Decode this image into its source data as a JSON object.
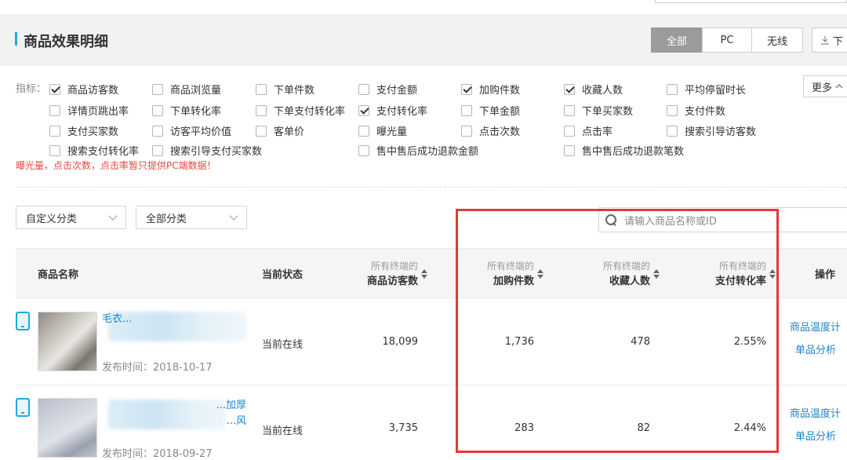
{
  "header": {
    "title": "商品效果明细",
    "tabs": [
      {
        "label": "全部",
        "active": true
      },
      {
        "label": "PC",
        "active": false
      },
      {
        "label": "无线",
        "active": false
      }
    ],
    "download_label": "下",
    "download_icon": "download-icon"
  },
  "metrics": {
    "label": "指标：",
    "items": [
      {
        "label": "商品访客数",
        "checked": true
      },
      {
        "label": "商品浏览量",
        "checked": false
      },
      {
        "label": "下单件数",
        "checked": false
      },
      {
        "label": "支付金额",
        "checked": false
      },
      {
        "label": "加购件数",
        "checked": true
      },
      {
        "label": "收藏人数",
        "checked": true
      },
      {
        "label": "平均停留时长",
        "checked": false
      },
      {
        "label": "详情页跳出率",
        "checked": false
      },
      {
        "label": "下单转化率",
        "checked": false
      },
      {
        "label": "下单支付转化率",
        "checked": false
      },
      {
        "label": "支付转化率",
        "checked": true
      },
      {
        "label": "下单金额",
        "checked": false
      },
      {
        "label": "下单买家数",
        "checked": false
      },
      {
        "label": "支付件数",
        "checked": false
      },
      {
        "label": "支付买家数",
        "checked": false
      },
      {
        "label": "访客平均价值",
        "checked": false
      },
      {
        "label": "客单价",
        "checked": false
      },
      {
        "label": "曝光量",
        "checked": false
      },
      {
        "label": "点击次数",
        "checked": false
      },
      {
        "label": "点击率",
        "checked": false
      },
      {
        "label": "搜索引导访客数",
        "checked": false
      },
      {
        "label": "搜索支付转化率",
        "checked": false
      },
      {
        "label": "搜索引导支付买家数",
        "checked": false
      },
      {
        "label": "售中售后成功退款金额",
        "checked": false
      },
      {
        "label": "售中售后成功退款笔数",
        "checked": false
      }
    ],
    "more_label": "更多",
    "warning": "曝光量，点击次数，点击率暂只提供PC端数据！"
  },
  "filters": {
    "category1": "自定义分类",
    "category2": "全部分类",
    "search_placeholder": "请输入商品名称或ID"
  },
  "table": {
    "headers": {
      "name": "商品名称",
      "status": "当前状态",
      "metric_prefix": "所有终端的",
      "visitors": "商品访客数",
      "cart": "加购件数",
      "favorites": "收藏人数",
      "conversion": "支付转化率",
      "actions": "操作"
    },
    "rows": [
      {
        "title": "毛衣...",
        "publish_time": "发布时间：2018-10-17",
        "status": "当前在线",
        "visitors": "18,099",
        "cart": "1,736",
        "favorites": "478",
        "conversion": "2.55%",
        "action1": "商品温度计",
        "action2": "单品分析"
      },
      {
        "title": "...加厚",
        "title2": "...风",
        "publish_time": "发布时间：2018-09-27",
        "status": "当前在线",
        "visitors": "3,735",
        "cart": "283",
        "favorites": "82",
        "conversion": "2.44%",
        "action1": "商品温度计",
        "action2": "单品分析"
      }
    ]
  },
  "colors": {
    "accent": "#1fa9e0",
    "link": "#1f83c7",
    "warning": "#e6493f",
    "highlight": "#e53935",
    "active_tab": "#9b9b9b"
  }
}
